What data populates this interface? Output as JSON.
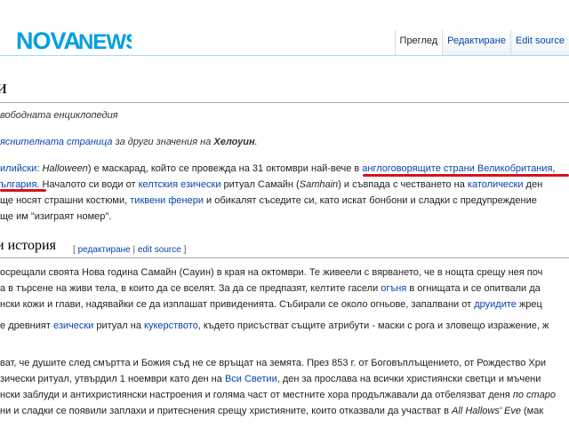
{
  "brand": {
    "logo_text": "NOVANEWS",
    "colors": {
      "primary": "#00a0df",
      "title": "#000000",
      "link": "#0645ad",
      "underline": "#d7121d"
    }
  },
  "tabs": [
    {
      "label": "Преглед",
      "active": true
    },
    {
      "label": "Редактиране",
      "active": false
    },
    {
      "label": "Edit source",
      "active": false
    }
  ],
  "article": {
    "title": "и",
    "tagline": "вободната енциклопедия",
    "hatnote": {
      "link": "яснителната страница",
      "text": " за други значения на ",
      "term": "Хелоуин",
      "end": "."
    },
    "intro": {
      "line1": {
        "a": "илийски",
        "b": ": ",
        "c": "Halloween",
        "d": ") е маскарад, който се провежда на 31 октомври най-вече в ",
        "e": "англоговорящите страни",
        "f": " ",
        "g": "Великобритания",
        "h": ","
      },
      "line2": {
        "a": "ългария",
        "b": ". Началото си води от ",
        "c": "келтския",
        "d": " ",
        "e": "езически",
        "f": " ритуал Самайн (",
        "g": "Samhain",
        "h": ") и съвпада с честването на ",
        "i": "католически",
        "j": " ден"
      },
      "line3": {
        "a": "ще носят страшни костюми, ",
        "b": "тиквени фенери",
        "c": " и обикалят съседите си, като искат бонбони и сладки с предупреждение"
      },
      "line4": "ще им \"изиграят номер\"."
    },
    "section": {
      "title": "и история",
      "edit_open": "[ ",
      "edit_link1": "редактиране",
      "edit_sep": " | ",
      "edit_link2": "edit source",
      "edit_close": " ]"
    },
    "history": {
      "p1": "осрещали своята Нова година Самайн (Сауин) в края на октомври. Те живеели с вярването, че в нощта срещу нея поч",
      "p2a": "а в търсене на живи тела, в които да се вселят. За да се предпазят, келтите гасели ",
      "p2b": "огъня",
      "p2c": " в огнищата и се опитвали да",
      "p3a": "нски кожи и глави, надявайки се да изплашат привиденията. Събирали се около огньове, запалвани от ",
      "p3b": "друидите",
      "p3c": " жрец",
      "p4a": "е древният ",
      "p4b": "езически",
      "p4c": " ритуал на ",
      "p4d": "кукерството",
      "p4e": ", където присъстват същите атрибути - маски с рога и зловещо изражение, ж",
      "p5": "ват, че душите след смъртта и Божия съд не се връщат на земята. През 853 г. от Боговъплъщението, от Рождество Хри",
      "p6a": "зически ритуал, утвърдил 1 ноември като ден на ",
      "p6b": "Вси Светии",
      "p6c": ", ден за прослава на всички християнски светци и мъчени",
      "p7a": "нски заблуди и антихристиянски настроения и голяма част от местните хора продължавали да отбелязват деня ",
      "p7b": "по старо",
      "p8a": "ни и сладки се появили заплахи и притеснения срещу християните, които отказвали да участват в ",
      "p8b": "All Hallows' Eve",
      "p8c": " (мак"
    }
  }
}
